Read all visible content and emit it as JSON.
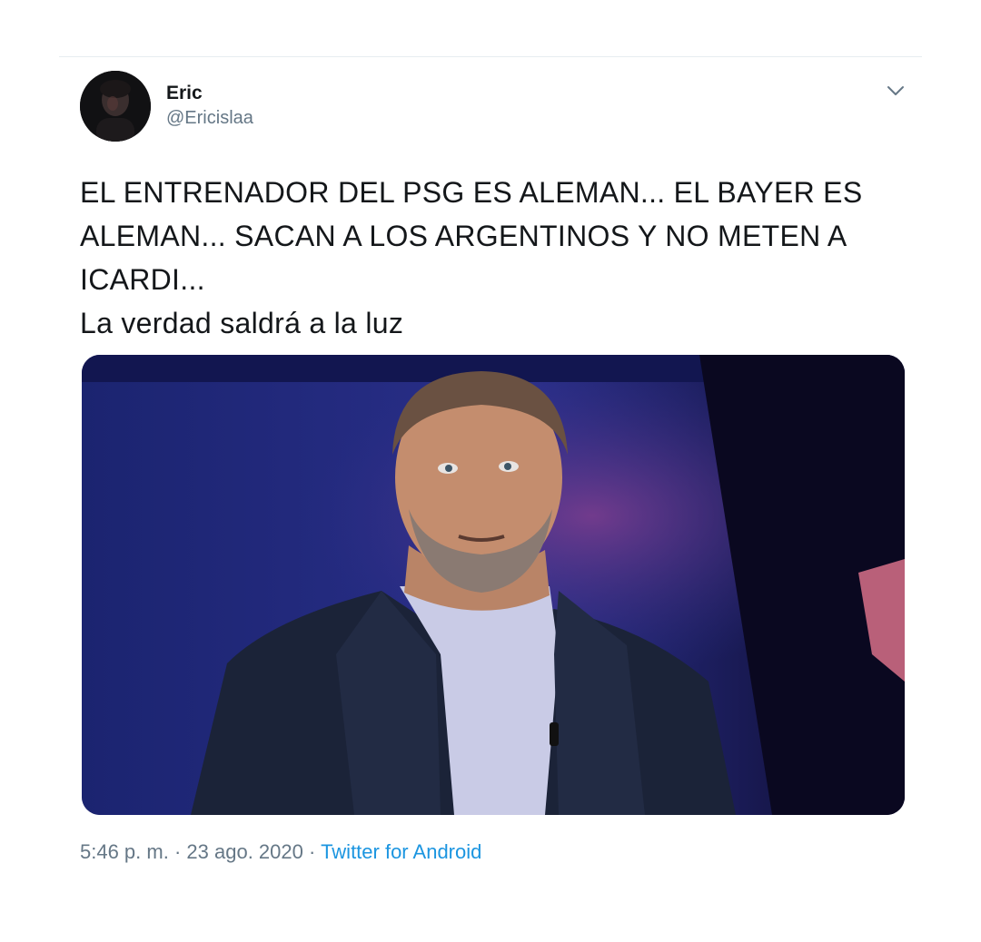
{
  "user": {
    "display_name": "Eric",
    "handle": "@Ericislaa"
  },
  "tweet": {
    "text_lines": [
      "EL ENTRENADOR DEL PSG ES ALEMAN... EL BAYER ES",
      "ALEMAN... SACAN A LOS ARGENTINOS Y NO METEN A",
      "ICARDI...",
      "La verdad saldrá a la luz"
    ],
    "time": "5:46 p. m.",
    "separator": "·",
    "date": "23 ago. 2020",
    "source": "Twitter for Android"
  },
  "icons": {
    "more": "chevron-down-icon",
    "avatar": "avatar-photo"
  },
  "colors": {
    "text": "#14171a",
    "secondary": "#657786",
    "link": "#1b95e0",
    "divider": "#e6ecf0"
  }
}
